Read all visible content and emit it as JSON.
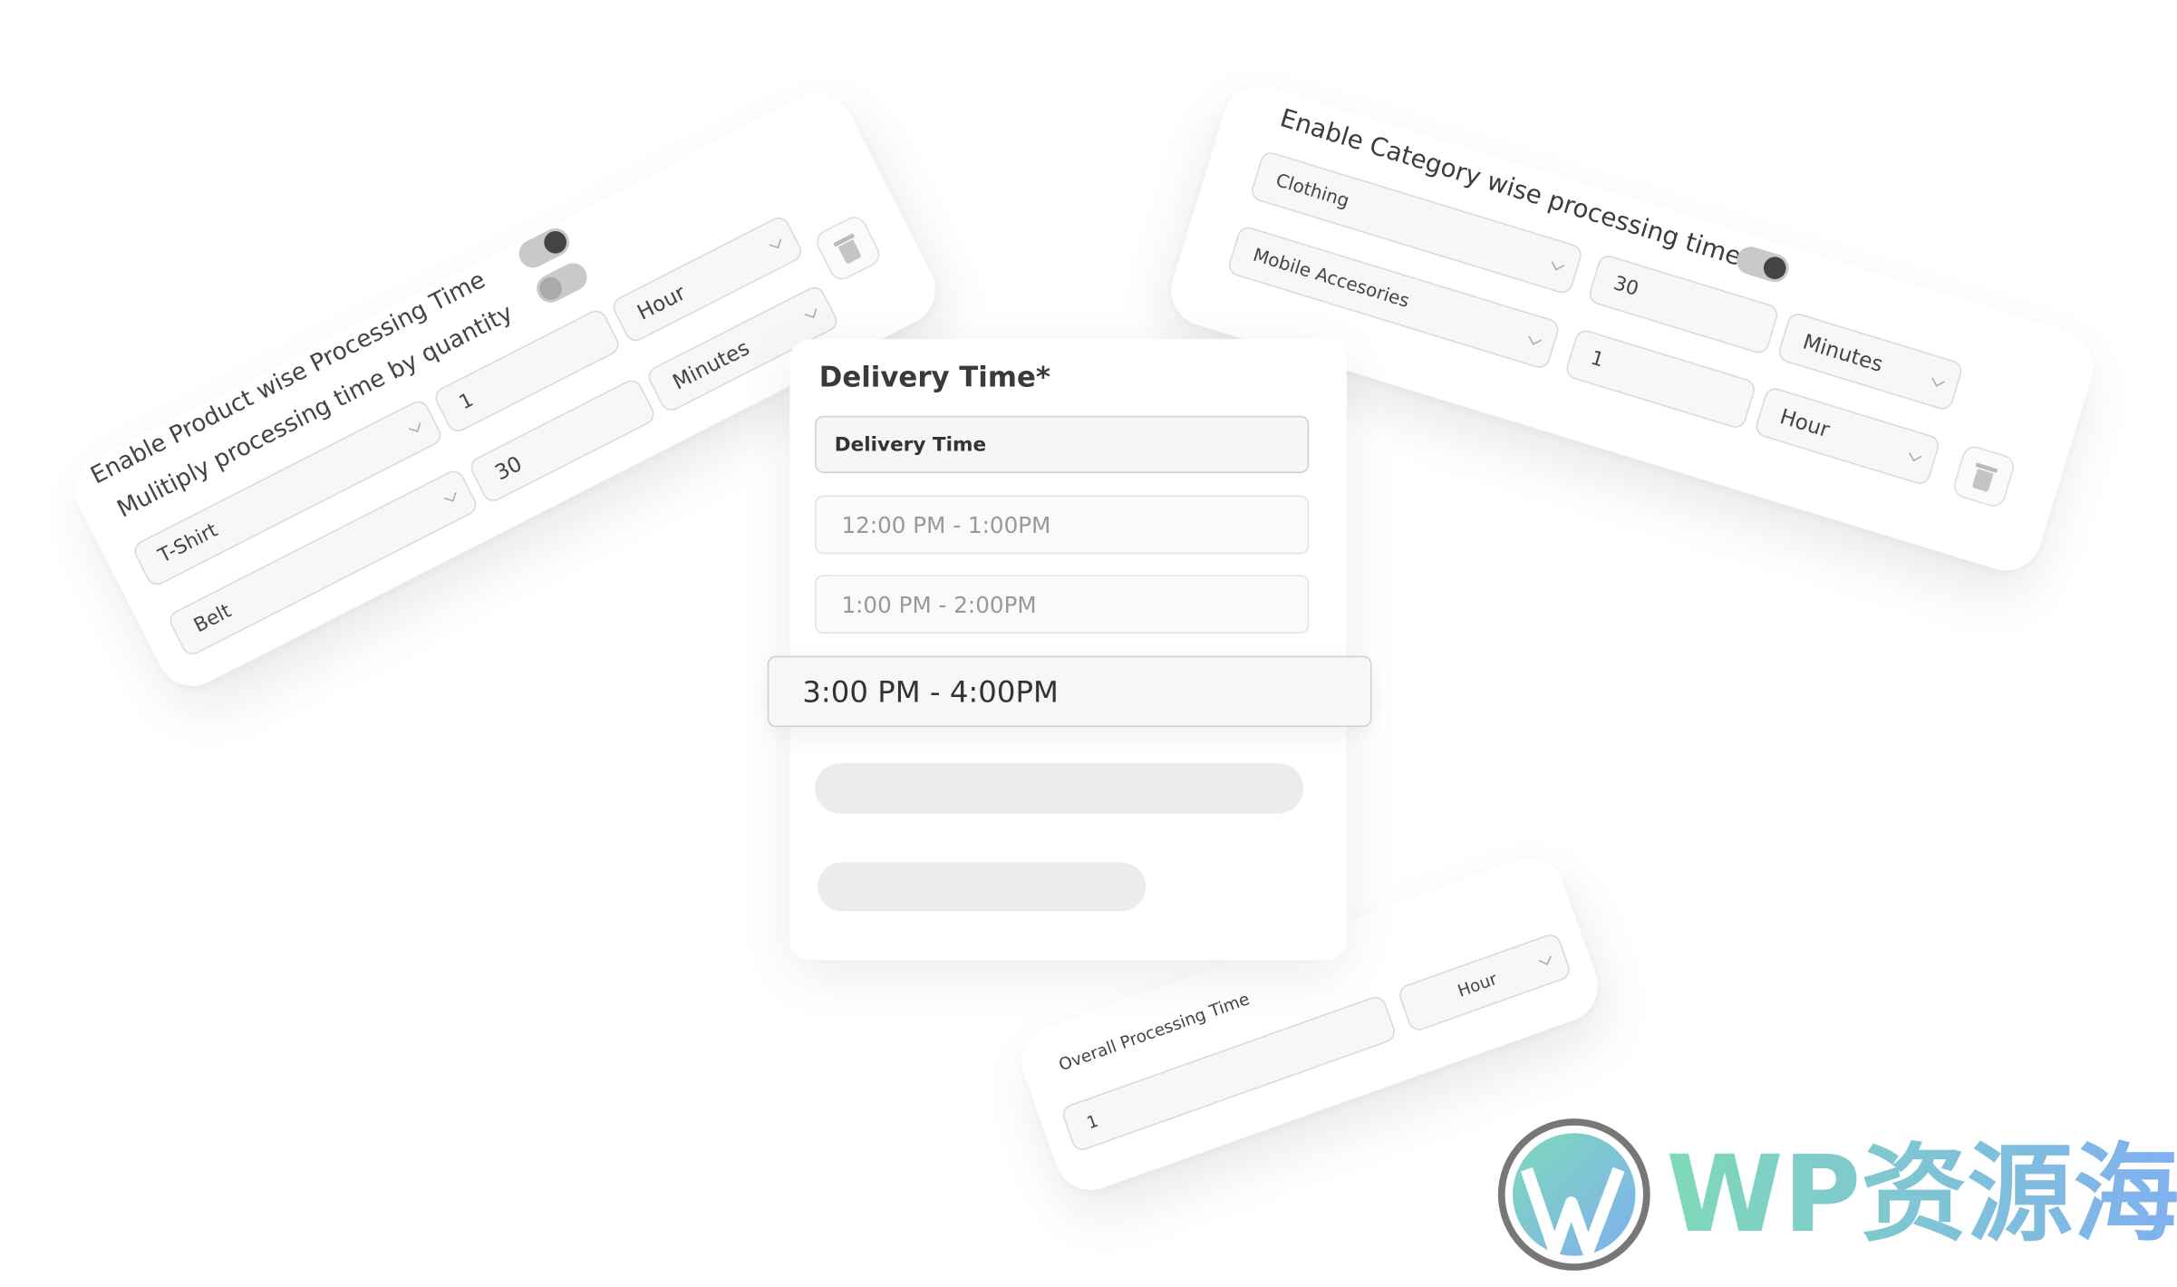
{
  "product_card": {
    "enable_label": "Enable Product wise Processing Time",
    "multiply_label": "Mulitiply processing time by quantity",
    "enable_toggle": "on",
    "multiply_toggle": "off",
    "rows": [
      {
        "product": "T-Shirt",
        "value": "1",
        "unit": "Hour"
      },
      {
        "product": "Belt",
        "value": "30",
        "unit": "Minutes"
      }
    ],
    "delete_icon": "trash-icon"
  },
  "category_card": {
    "enable_label": "Enable Category wise processing time",
    "enable_toggle": "on",
    "rows": [
      {
        "category": "Clothing",
        "value": "30",
        "unit": "Minutes"
      },
      {
        "category": "Mobile Accesories",
        "value": "1",
        "unit": "Hour"
      }
    ],
    "delete_icon": "trash-icon"
  },
  "delivery_card": {
    "title": "Delivery Time*",
    "select_value": "Delivery Time",
    "options": [
      "12:00 PM -  1:00PM",
      "1:00 PM -  2:00PM",
      "3:00 PM -  4:00PM"
    ],
    "highlighted_option": "3:00 PM -  4:00PM"
  },
  "overall_card": {
    "label": "Overall Processing  Time",
    "value": "1",
    "unit": "Hour"
  },
  "watermark": {
    "text": "WP资源海",
    "colors": [
      "#7fd9b9",
      "#7fb0f0"
    ]
  }
}
